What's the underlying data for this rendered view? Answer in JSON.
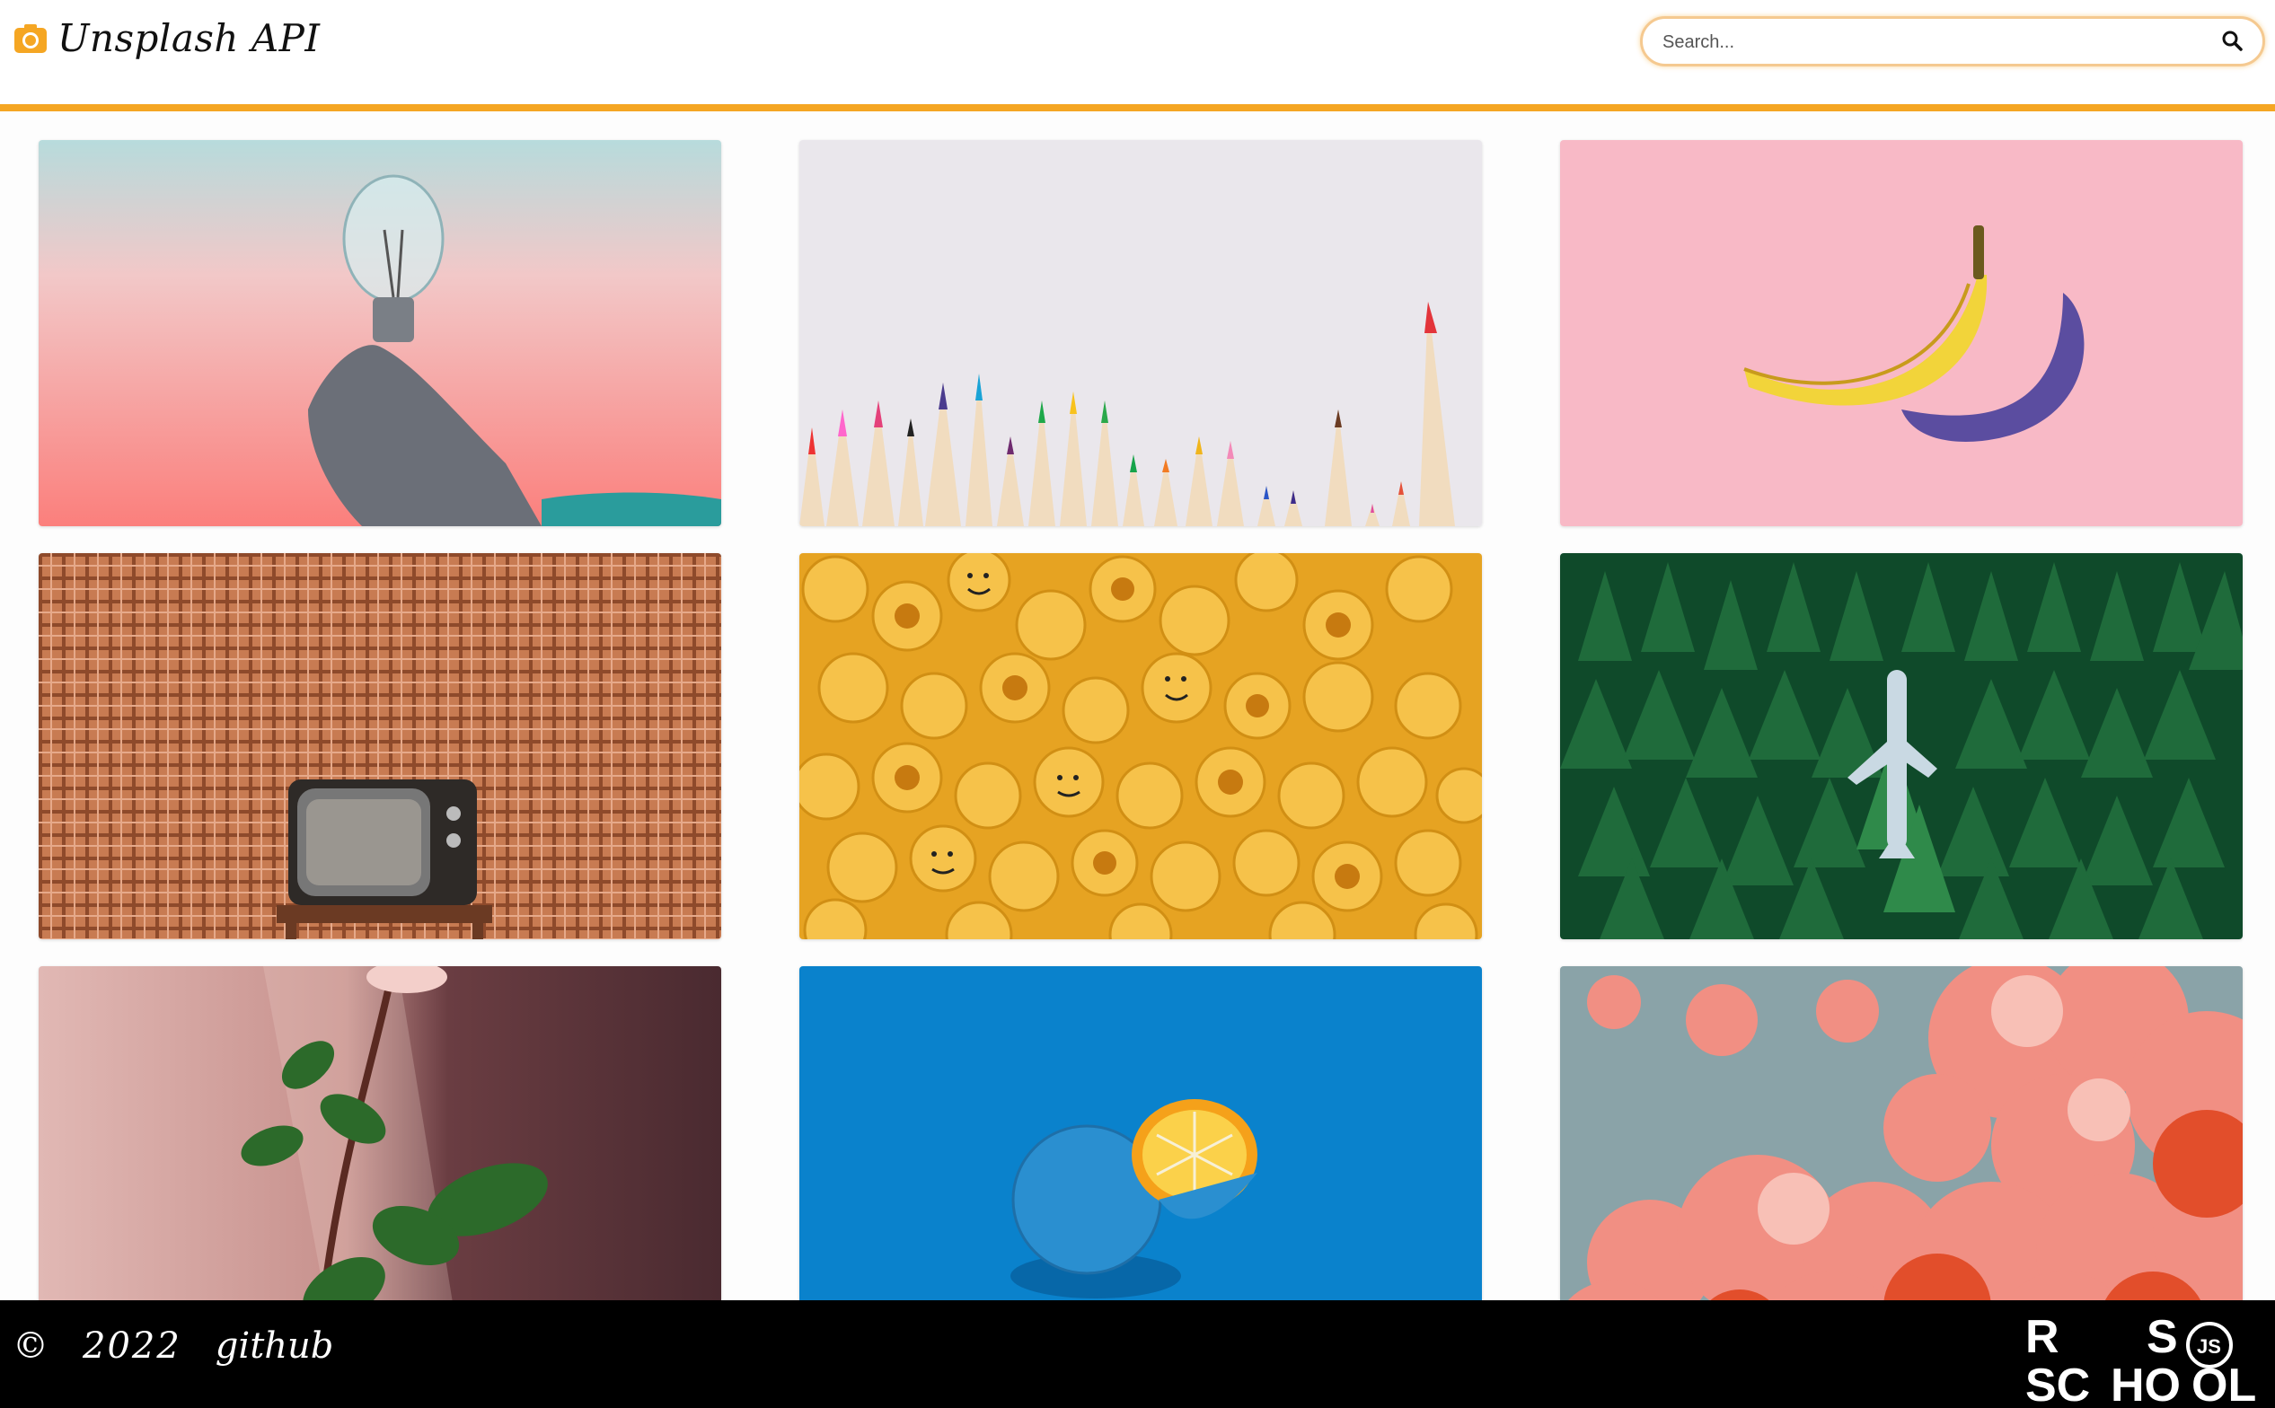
{
  "header": {
    "icon": "camera-icon",
    "title": "Unsplash API",
    "accent_color": "#f5a623"
  },
  "search": {
    "placeholder": "Search...",
    "value": "",
    "icon": "search-icon"
  },
  "gallery": {
    "images": [
      {
        "subject": "hand-holding-light-bulb"
      },
      {
        "subject": "colored-pencils"
      },
      {
        "subject": "banana-on-pink"
      },
      {
        "subject": "retro-tv-plaid-wall"
      },
      {
        "subject": "lego-heads"
      },
      {
        "subject": "airplane-in-forest"
      },
      {
        "subject": "rose-stem"
      },
      {
        "subject": "blue-painted-orange"
      },
      {
        "subject": "pink-clouds"
      }
    ]
  },
  "footer": {
    "copyright": "©",
    "year": "2022",
    "github_label": "github",
    "logo": "rs-school-js-logo",
    "logo_lines": [
      "R",
      "S",
      "SC",
      "HO",
      "OL",
      "JS"
    ]
  }
}
